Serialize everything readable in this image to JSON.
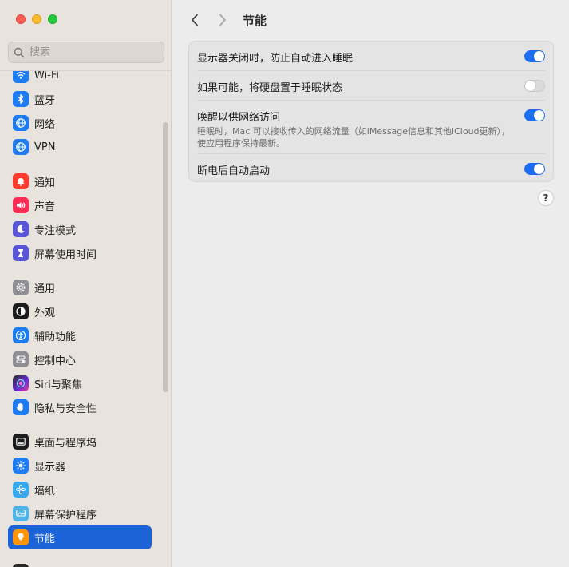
{
  "window": {
    "title": "节能"
  },
  "search": {
    "placeholder": "搜索"
  },
  "sidebar": {
    "items": [
      {
        "label": "Wi-Fi",
        "icon": "wifi-icon",
        "color": "#1e7cf2"
      },
      {
        "label": "蓝牙",
        "icon": "bluetooth-icon",
        "color": "#1e7cf2"
      },
      {
        "label": "网络",
        "icon": "globe-icon",
        "color": "#1e7cf2"
      },
      {
        "label": "VPN",
        "icon": "vpn-globe-icon",
        "color": "#1e7cf2"
      },
      {
        "label": "通知",
        "icon": "bell-icon",
        "color": "#ff3b30"
      },
      {
        "label": "声音",
        "icon": "speaker-icon",
        "color": "#ff2d55"
      },
      {
        "label": "专注模式",
        "icon": "moon-icon",
        "color": "#5856d6"
      },
      {
        "label": "屏幕使用时间",
        "icon": "hourglass-icon",
        "color": "#5856d6"
      },
      {
        "label": "通用",
        "icon": "gear-icon",
        "color": "#8e8e93"
      },
      {
        "label": "外观",
        "icon": "appearance-icon",
        "color": "#1c1c1e"
      },
      {
        "label": "辅助功能",
        "icon": "accessibility-icon",
        "color": "#1e7cf2"
      },
      {
        "label": "控制中心",
        "icon": "control-center-icon",
        "color": "#8e8e93"
      },
      {
        "label": "Siri与聚焦",
        "icon": "siri-icon",
        "color": "#6b2bd8"
      },
      {
        "label": "隐私与安全性",
        "icon": "hand-icon",
        "color": "#1e7cf2"
      },
      {
        "label": "桌面与程序坞",
        "icon": "dock-icon",
        "color": "#1c1c1e"
      },
      {
        "label": "显示器",
        "icon": "sun-icon",
        "color": "#1e7cf2"
      },
      {
        "label": "墙纸",
        "icon": "flower-icon",
        "color": "#35aaf2"
      },
      {
        "label": "屏幕保护程序",
        "icon": "screensaver-icon",
        "color": "#4fb4e8"
      },
      {
        "label": "节能",
        "icon": "lightbulb-icon",
        "color": "#ff9500"
      }
    ]
  },
  "settings": {
    "rows": [
      {
        "label": "显示器关闭时，防止自动进入睡眠",
        "enabled": true
      },
      {
        "label": "如果可能，将硬盘置于睡眠状态",
        "enabled": false
      },
      {
        "label": "唤醒以供网络访问",
        "description": "睡眠时，Mac 可以接收传入的网络流量（如iMessage信息和其他iCloud更新），使应用程序保持最新。",
        "enabled": true
      },
      {
        "label": "断电后自动启动",
        "enabled": true
      }
    ]
  },
  "help": {
    "label": "?"
  },
  "colors": {
    "accent": "#1b63d6",
    "toggle_on": "#1b6ef3"
  }
}
